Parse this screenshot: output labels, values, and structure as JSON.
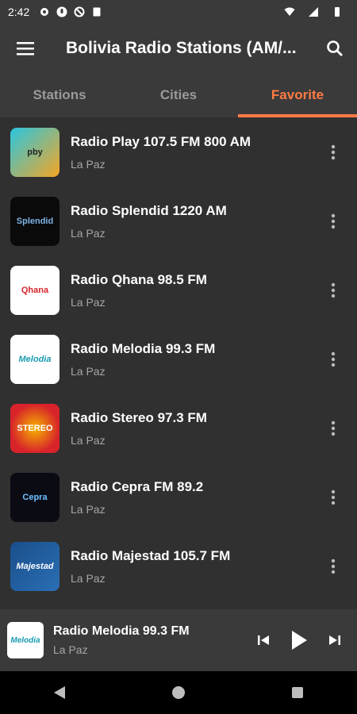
{
  "status_bar": {
    "time": "2:42"
  },
  "app_bar": {
    "title": "Bolivia Radio Stations (AM/..."
  },
  "tabs": [
    {
      "label": "Stations",
      "active": false
    },
    {
      "label": "Cities",
      "active": false
    },
    {
      "label": "Favorite",
      "active": true
    }
  ],
  "stations": [
    {
      "name": "Radio Play 107.5 FM 800 AM",
      "city": "La Paz",
      "logo_text": "pby",
      "logo_bg": "#f5a623"
    },
    {
      "name": "Radio Splendid 1220 AM",
      "city": "La Paz",
      "logo_text": "Splendid",
      "logo_bg": "#0a0a0a"
    },
    {
      "name": "Radio Qhana 98.5 FM",
      "city": "La Paz",
      "logo_text": "Qhana",
      "logo_bg": "#ffffff"
    },
    {
      "name": "Radio Melodia 99.3 FM",
      "city": "La Paz",
      "logo_text": "Melodia",
      "logo_bg": "#ffffff"
    },
    {
      "name": "Radio Stereo 97.3 FM",
      "city": "La Paz",
      "logo_text": "STEREO",
      "logo_bg": "#d8232a"
    },
    {
      "name": "Radio Cepra FM 89.2",
      "city": "La Paz",
      "logo_text": "Cepra",
      "logo_bg": "#0b0b14"
    },
    {
      "name": "Radio Majestad 105.7 FM",
      "city": "La Paz",
      "logo_text": "Majestad",
      "logo_bg": "#1a4e8a"
    }
  ],
  "mini_player": {
    "name": "Radio Melodia 99.3 FM",
    "city": "La Paz",
    "logo_text": "Melodia"
  },
  "colors": {
    "accent": "#ff7b45",
    "background": "#303030",
    "bar": "#3a3a3a"
  }
}
